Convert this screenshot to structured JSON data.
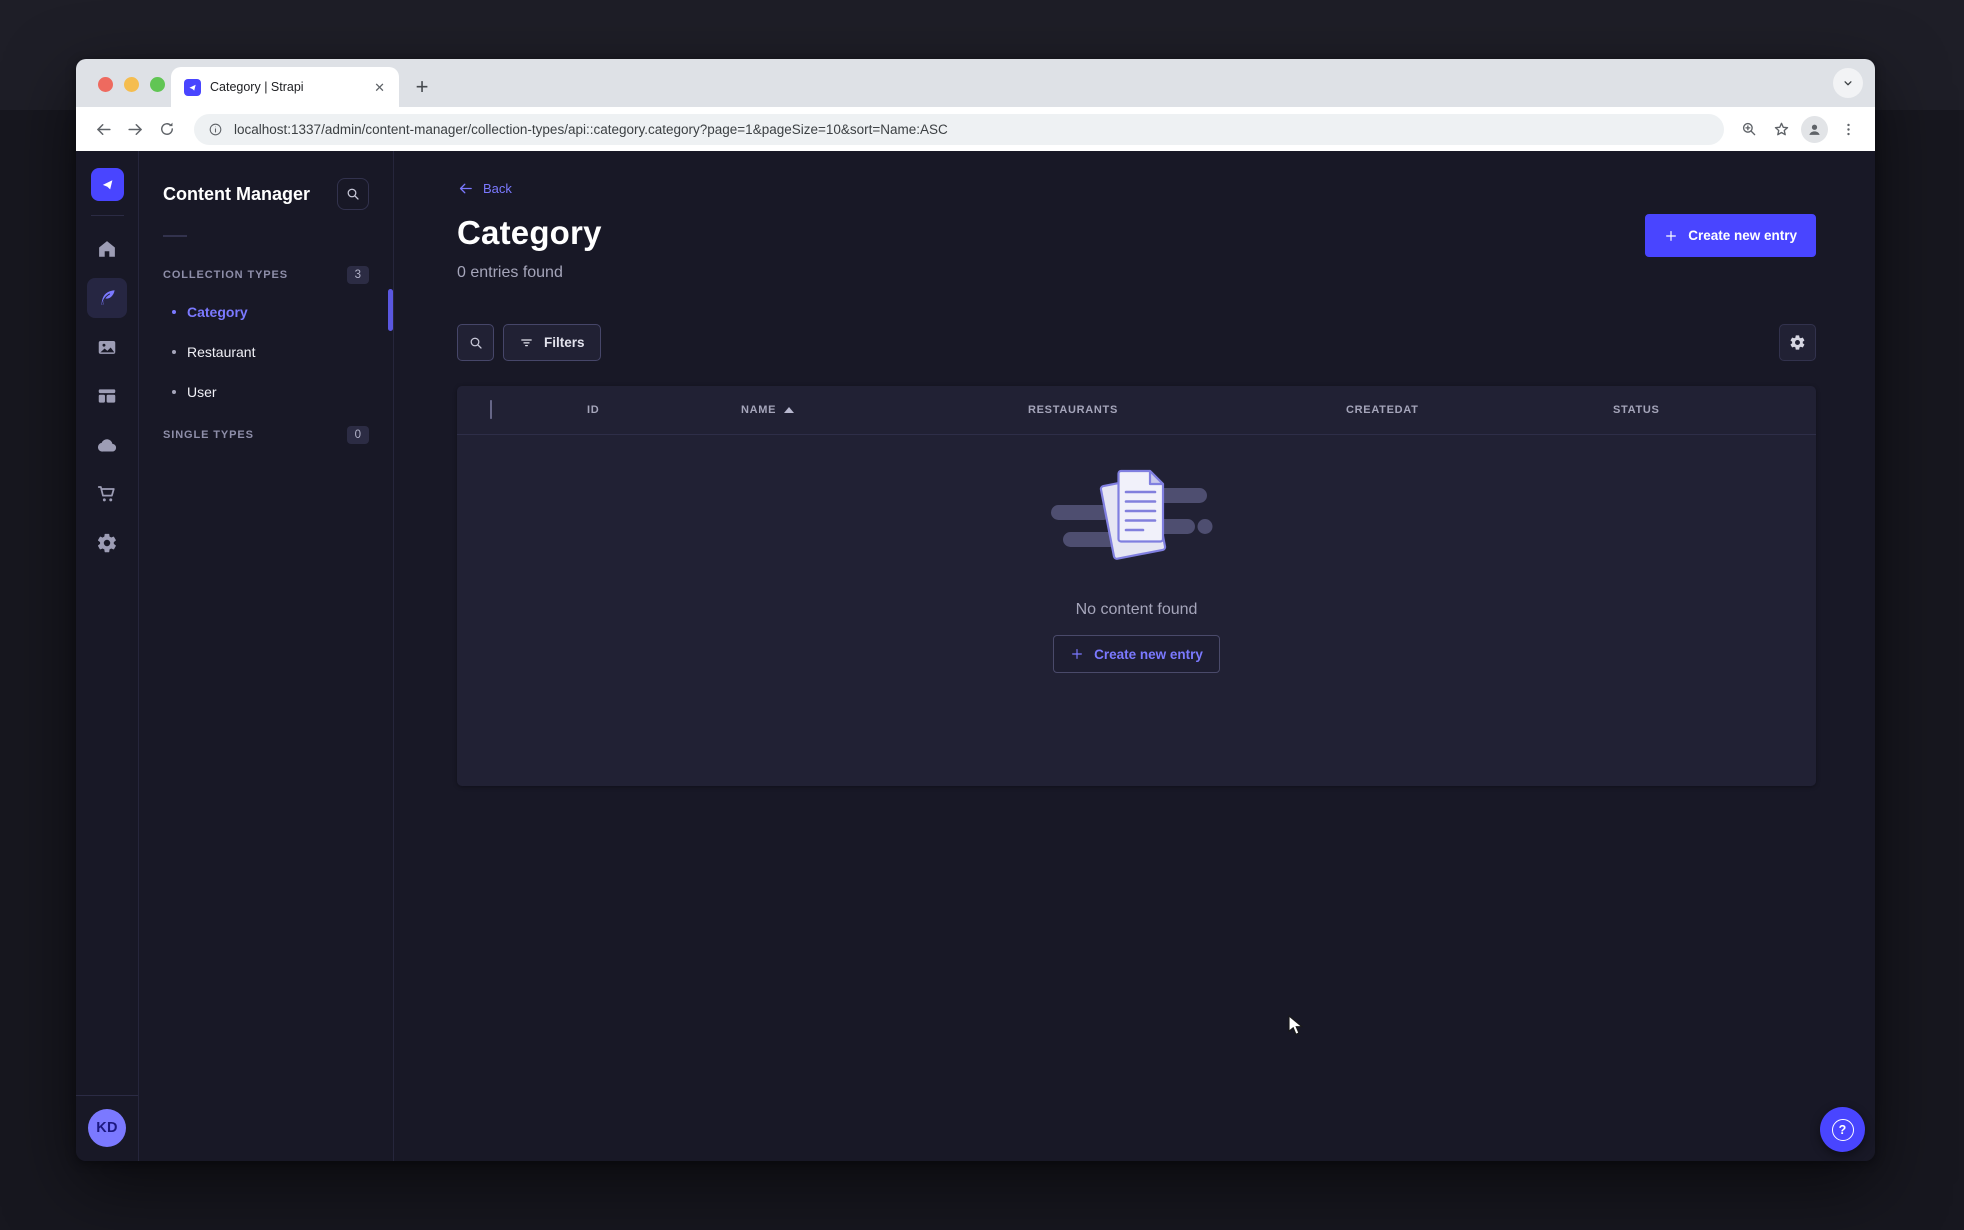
{
  "browser": {
    "tab": {
      "title": "Category | Strapi",
      "close_glyph": "✕",
      "new_tab_glyph": "+"
    },
    "address": {
      "url": "localhost:1337/admin/content-manager/collection-types/api::category.category?page=1&pageSize=10&sort=Name:ASC"
    }
  },
  "mininav": {
    "icons": [
      "strapi-logo",
      "home",
      "content-manager",
      "media-library",
      "content-type-builder",
      "cloud",
      "marketplace",
      "settings"
    ],
    "avatar_initials": "KD"
  },
  "subnav": {
    "title": "Content Manager",
    "collection_types": {
      "label": "COLLECTION TYPES",
      "badge": "3",
      "items": [
        {
          "label": "Category",
          "active": true
        },
        {
          "label": "Restaurant",
          "active": false
        },
        {
          "label": "User",
          "active": false
        }
      ]
    },
    "single_types": {
      "label": "SINGLE TYPES",
      "badge": "0"
    }
  },
  "main": {
    "back_label": "Back",
    "title": "Category",
    "subtitle": "0 entries found",
    "create_button_label": "Create new entry",
    "filters_label": "Filters",
    "table_headers": [
      "ID",
      "NAME",
      "RESTAURANTS",
      "CREATEDAT",
      "STATUS"
    ],
    "empty_state": {
      "message": "No content found",
      "cta_label": "Create new entry"
    }
  },
  "help": {
    "glyph": "?"
  },
  "colors": {
    "accent": "#4945ff",
    "accent_light": "#7b79ff",
    "card_bg": "#212134",
    "app_bg": "#181826"
  }
}
